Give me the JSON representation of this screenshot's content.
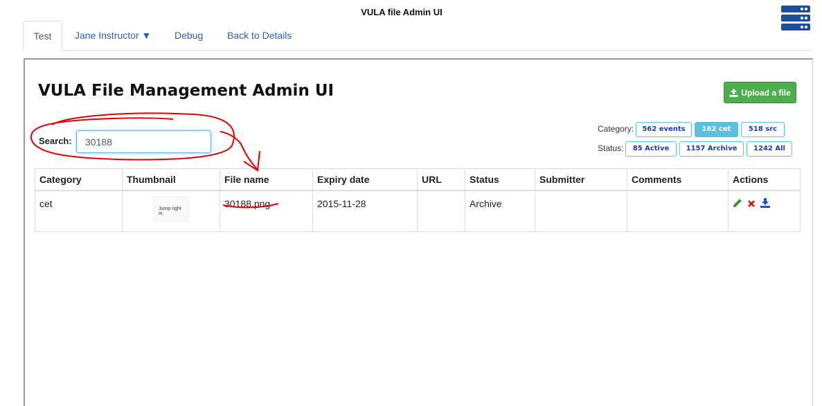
{
  "app_title": "VULA file Admin UI",
  "tabs": [
    {
      "label": "Test",
      "active": true
    },
    {
      "label": "Jane Instructor ▼"
    },
    {
      "label": "Debug"
    },
    {
      "label": "Back to Details"
    }
  ],
  "page_title": "VULA File Management Admin UI",
  "upload_button": {
    "label": "Upload a file",
    "icon": "upload-icon"
  },
  "search": {
    "label": "Search:",
    "value": "30188"
  },
  "filters": {
    "category_label": "Category:",
    "category_chips": [
      "562 events",
      "162 cet",
      "518 src"
    ],
    "status_label": "Status:",
    "status_chips": [
      "85 Active",
      "1157 Archive",
      "1242 All"
    ]
  },
  "table": {
    "headers": [
      "Category",
      "Thumbnail",
      "File name",
      "Expiry date",
      "URL",
      "Status",
      "Submitter",
      "Comments",
      "Actions"
    ],
    "rows": [
      {
        "category": "cet",
        "thumbnail_title": "Jump right in.",
        "file_name": "30188.png",
        "expiry_date": "2015-11-28",
        "url": "",
        "status": "Archive",
        "submitter": "",
        "comments": ""
      }
    ],
    "action_icons": [
      "edit-pencil-icon",
      "delete-x-icon",
      "download-icon"
    ]
  },
  "colors": {
    "primary": "#2a5fb0",
    "success": "#4cae4c",
    "info": "#5bc0de",
    "annotation": "#e00000"
  }
}
